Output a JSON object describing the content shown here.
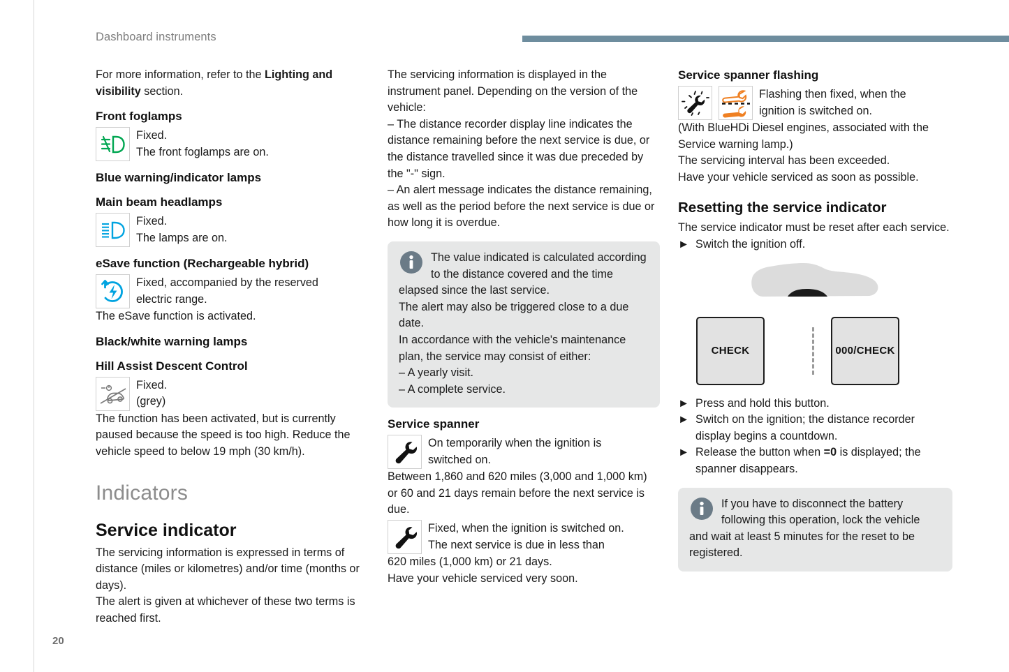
{
  "header": {
    "title": "Dashboard instruments",
    "rule_color": "#6e8d9e"
  },
  "page_number": "20",
  "col1": {
    "intro_1": "For more information, refer to the ",
    "intro_bold": "Lighting and visibility",
    "intro_2": " section.",
    "front_foglamps_heading": "Front foglamps",
    "front_foglamps_line1": "Fixed.",
    "front_foglamps_line2": "The front foglamps are on.",
    "blue_lamps_heading": "Blue warning/indicator lamps",
    "main_beam_heading": "Main beam headlamps",
    "main_beam_line1": "Fixed.",
    "main_beam_line2": "The lamps are on.",
    "esave_heading": "eSave function (Rechargeable hybrid)",
    "esave_line1": "Fixed, accompanied by the reserved",
    "esave_line2": "electric range.",
    "esave_after": "The eSave function is activated.",
    "blackwhite_heading": "Black/white warning lamps",
    "hill_assist_heading": "Hill Assist Descent Control",
    "hill_assist_line1": "Fixed.",
    "hill_assist_line2": "(grey)",
    "hill_assist_body": "The function has been activated, but is currently paused because the speed is too high. Reduce the vehicle speed to below 19 mph (30 km/h).",
    "indicators_heading": "Indicators",
    "service_indicator_heading": "Service indicator",
    "service_indicator_body1": "The servicing information is expressed in terms of distance (miles or kilometres) and/or time (months or days).",
    "service_indicator_body2": "The alert is given at whichever of these two terms is reached first."
  },
  "col2": {
    "para1": "The servicing information is displayed in the instrument panel. Depending on the version of the vehicle:",
    "bullet1": "–  The distance recorder display line indicates the distance remaining before the next service is due, or the distance travelled since it was due preceded by the \"-\" sign.",
    "bullet2": "–  An alert message indicates the distance remaining, as well as the period before the next service is due or how long it is overdue.",
    "callout": {
      "icon": "info-icon",
      "line1": "The value indicated is calculated according to the distance covered and the time elapsed since the last service.",
      "line2": "The alert may also be triggered close to a due date.",
      "line3": "In accordance with the vehicle's maintenance plan, the service may consist of either:",
      "item1": "–  A yearly visit.",
      "item2": "–  A complete service."
    },
    "service_spanner_heading": "Service spanner",
    "spanner1_line1": "On temporarily when the ignition is",
    "spanner1_line2": "switched on.",
    "spanner1_after": "Between 1,860 and 620 miles (3,000 and 1,000 km) or 60 and 21 days remain before the next service is due.",
    "spanner2_line1": "Fixed, when the ignition is switched on.",
    "spanner2_line2": "The next service is due in less than",
    "spanner2_after1": "620 miles (1,000 km) or 21 days.",
    "spanner2_after2": "Have your vehicle serviced very soon."
  },
  "col3": {
    "flashing_heading": "Service spanner flashing",
    "flashing_line1": "Flashing then fixed, when the",
    "flashing_line2": "ignition is switched on.",
    "flashing_after1": "(With BlueHDi Diesel engines, associated with the Service warning lamp.)",
    "flashing_after2": "The servicing interval has been exceeded.",
    "flashing_after3": "Have your vehicle serviced as soon as possible.",
    "reset_heading": "Resetting the service indicator",
    "reset_body": "The service indicator must be reset after each service.",
    "reset_step0": "Switch the ignition off.",
    "diagram": {
      "button_left_label": "CHECK",
      "button_right_label": "000/CHECK",
      "car_icon": "car-silhouette-icon"
    },
    "step1": "Press and hold this button.",
    "step2": "Switch on the ignition; the distance recorder display begins a countdown.",
    "step3_pre": "Release the button when ",
    "step3_bold": "=0",
    "step3_post": " is displayed; the spanner disappears.",
    "callout": {
      "icon": "info-icon",
      "text": "If you have to disconnect the battery following this operation, lock the vehicle and wait at least 5 minutes for the reset to be registered."
    }
  },
  "colors": {
    "accent_bar": "#6e8d9e",
    "foglamp_green": "#00a651",
    "main_beam_blue": "#00a3e0",
    "esave_blue": "#00a3e0",
    "spanner_orange": "#ef8022",
    "callout_bg": "#e6e7e7",
    "info_icon": "#6b7b87"
  }
}
